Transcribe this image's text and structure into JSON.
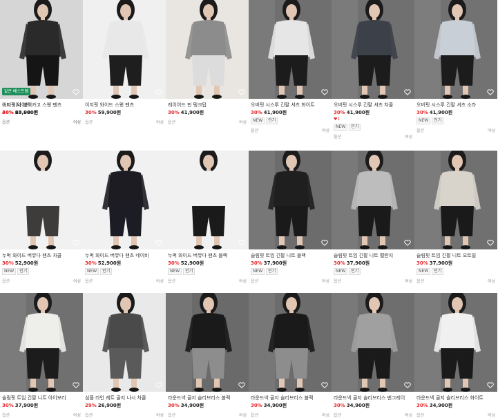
{
  "products": [
    {
      "name": "이지핏 와이드 카고 스웻 팬츠",
      "discount": "30%",
      "price": "68,900원",
      "bg": "#eeeeee",
      "top": "#3a3a3a",
      "bottom": "#a9a9a9",
      "tags": [],
      "likes": "",
      "shade": "light"
    },
    {
      "name": "이지핏 와이드 스웻 팬츠",
      "discount": "30%",
      "price": "59,900원",
      "bg": "#f0f0f0",
      "top": "#e8e8e8",
      "bottom": "#1e1e1e",
      "tags": [],
      "likes": "",
      "shade": "light"
    },
    {
      "name": "레이어드 핀 탱크탑",
      "discount": "30%",
      "price": "41,900원",
      "bg": "#e9e6e2",
      "top": "#8c8c8c",
      "bottom": "#dcdcdc",
      "tags": [],
      "likes": "",
      "shade": "light"
    },
    {
      "name": "오버핏 시스루 긴팔 셔츠 화이트",
      "discount": "30%",
      "price": "41,900원",
      "bg": "#6f6f6f",
      "top": "#e6e6e6",
      "bottom": "#1c1c1c",
      "tags": [
        "NEW",
        "인기"
      ],
      "likes": "",
      "shade": "dark"
    },
    {
      "name": "오버핏 시스루 긴팔 셔츠 차콜",
      "discount": "30%",
      "price": "41,900원",
      "bg": "#707070",
      "top": "#3c4048",
      "bottom": "#1c1c1c",
      "tags": [
        "NEW",
        "인기"
      ],
      "likes": "1",
      "shade": "dark"
    },
    {
      "name": "오버핏 시스루 긴팔 셔츠 소라",
      "discount": "30%",
      "price": "41,900원",
      "bg": "#727272",
      "top": "#c9cfd6",
      "bottom": "#1c1c1c",
      "tags": [
        "NEW",
        "인기"
      ],
      "likes": "",
      "shade": "dark"
    },
    {
      "name": "누벅 와이드 버뮤다 팬츠 차콜",
      "discount": "30%",
      "price": "52,900원",
      "bg": "#f1f1f1",
      "top": "#f1f1f1",
      "bottom": "#3e3c3a",
      "tags": [
        "NEW",
        "인기"
      ],
      "likes": "",
      "shade": "light"
    },
    {
      "name": "누벅 와이드 버뮤다 팬츠 네이비",
      "discount": "30%",
      "price": "52,900원",
      "bg": "#f1f1f1",
      "top": "#1c1c22",
      "bottom": "#1c1d24",
      "tags": [
        "NEW",
        "인기"
      ],
      "likes": "",
      "shade": "light"
    },
    {
      "name": "누벅 와이드 버뮤다 팬츠 블랙",
      "discount": "30%",
      "price": "52,900원",
      "bg": "#f1f1f1",
      "top": "#f1f1f1",
      "bottom": "#1a1a1a",
      "tags": [
        "NEW",
        "인기"
      ],
      "likes": "",
      "shade": "light"
    },
    {
      "name": "슬림핏 트임 긴팔 니트 블랙",
      "discount": "30%",
      "price": "37,900원",
      "bg": "#6c6c6c",
      "top": "#1f1f1f",
      "bottom": "#1a1a1a",
      "tags": [
        "NEW",
        "인기"
      ],
      "likes": "",
      "shade": "dark"
    },
    {
      "name": "슬림핏 트임 긴팔 니트 멜란지",
      "discount": "30%",
      "price": "37,900원",
      "bg": "#6e6e6e",
      "top": "#bdbdbd",
      "bottom": "#1a1a1a",
      "tags": [
        "NEW",
        "인기"
      ],
      "likes": "",
      "shade": "dark"
    },
    {
      "name": "슬림핏 트임 긴팔 니트 오트밀",
      "discount": "30%",
      "price": "37,900원",
      "bg": "#707070",
      "top": "#d8d4cc",
      "bottom": "#1a1a1a",
      "tags": [
        "NEW",
        "인기"
      ],
      "likes": "",
      "shade": "dark"
    },
    {
      "name": "슬림핏 트임 긴팔 니트 아이보리",
      "discount": "30%",
      "price": "37,900원",
      "bg": "#707070",
      "top": "#eeeeea",
      "bottom": "#1c1c1c",
      "tags": [],
      "likes": "",
      "shade": "dark"
    },
    {
      "name": "심플 라인 레트 골지 나시 차콜",
      "discount": "29%",
      "price": "26,900원",
      "bg": "#e9e9e9",
      "top": "#4a4a4a",
      "bottom": "#5a5a5a",
      "tags": [],
      "likes": "",
      "shade": "light"
    },
    {
      "name": "라운드넥 골지 슬리브리스 블랙",
      "discount": "30%",
      "price": "34,900원",
      "bg": "#6a6a6a",
      "top": "#1a1a1a",
      "bottom": "#8d8d8d",
      "tags": [],
      "likes": "",
      "shade": "dark"
    },
    {
      "name": "라운드넥 골지 슬리브리스 블랙",
      "discount": "30%",
      "price": "34,900원",
      "bg": "#6c6c6c",
      "top": "#1a1a1a",
      "bottom": "#8d8d8d",
      "tags": [],
      "likes": "",
      "shade": "dark"
    },
    {
      "name": "라운드넥 골지 슬리브리스 멘그레이",
      "discount": "30%",
      "price": "34,900원",
      "bg": "#6e6e6e",
      "top": "#a0a0a0",
      "bottom": "#1a1a1a",
      "tags": [],
      "likes": "",
      "shade": "dark"
    },
    {
      "name": "라운드넥 골지 슬리브리스 화이트",
      "discount": "30%",
      "price": "34,900원",
      "bg": "#707070",
      "top": "#f0f0f0",
      "bottom": "#1a1a1a",
      "tags": [],
      "likes": "",
      "shade": "dark"
    },
    {
      "name": "스타 비니 블랙",
      "discount": "46%",
      "price": "23,040원",
      "bg": "#d6d6d6",
      "top": "#2a2a2a",
      "bottom": "#151515",
      "tags": [],
      "likes": "",
      "shade": "light",
      "ribbon": "같은 베스트템"
    }
  ],
  "labels": {
    "option": "옵션",
    "category": "여성"
  },
  "colors": {
    "discount": "#e8282d",
    "heart": "#e8282d"
  }
}
